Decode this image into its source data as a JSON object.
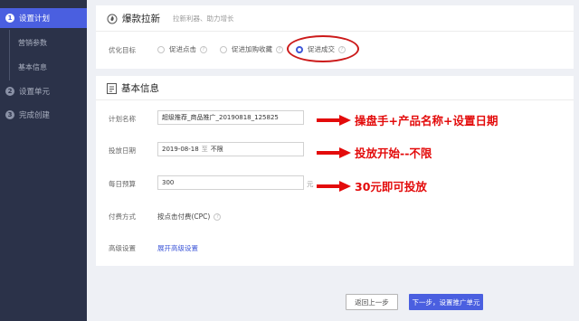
{
  "sidebar": {
    "steps": [
      {
        "num": "1",
        "label": "设置计划"
      },
      {
        "num": "2",
        "label": "设置单元"
      },
      {
        "num": "3",
        "label": "完成创建"
      }
    ],
    "subitems": [
      "营销参数",
      "基本信息"
    ]
  },
  "card1": {
    "title": "爆款拉新",
    "subtitle": "拉新利器、助力增长",
    "goal_label": "优化目标",
    "options": [
      {
        "label": "促进点击",
        "selected": false
      },
      {
        "label": "促进加购收藏",
        "selected": false
      },
      {
        "label": "促进成交",
        "selected": true
      }
    ],
    "help_glyph": "?"
  },
  "card2": {
    "title": "基本信息",
    "plan_name_label": "计划名称",
    "plan_name_value": "超级推荐_商品推广_20190818_125825",
    "date_label": "投放日期",
    "start_date": "2019-08-18",
    "date_sep": "至",
    "end_date": "不限",
    "budget_label": "每日预算",
    "budget_value": "300",
    "budget_unit": "元",
    "pay_label": "付费方式",
    "pay_value": "按点击付费(CPC)",
    "advanced_label": "高级设置",
    "advanced_link": "展开高级设置"
  },
  "annotations": [
    "操盘手+产品名称+设置日期",
    "投放开始--不限",
    "30元即可投放"
  ],
  "buttons": {
    "back": "返回上一步",
    "next": "下一步，设置推广单元"
  },
  "colors": {
    "sidebar_bg": "#2b3249",
    "accent": "#4a5fe0",
    "annotation_red": "#e30b0b"
  }
}
